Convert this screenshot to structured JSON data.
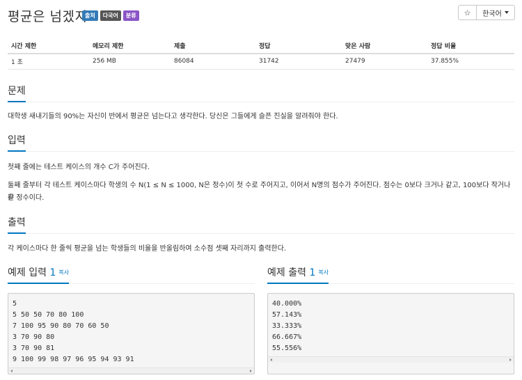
{
  "problem": {
    "title": "평균은 넘겠지",
    "badges": [
      "출처",
      "다국어",
      "분류"
    ]
  },
  "controls": {
    "star_icon": "☆",
    "language": "한국어"
  },
  "info_table": {
    "headers": [
      "시간 제한",
      "메모리 제한",
      "제출",
      "정답",
      "맞은 사람",
      "정답 비율"
    ],
    "values": [
      "1 초",
      "256 MB",
      "86084",
      "31742",
      "27479",
      "37.855%"
    ]
  },
  "sections": {
    "description": {
      "heading": "문제",
      "text": "대학생 새내기들의 90%는 자신이 반에서 평균은 넘는다고 생각한다. 당신은 그들에게 슬픈 진실을 알려줘야 한다."
    },
    "input": {
      "heading": "입력",
      "line1": "첫째 줄에는 테스트 케이스의 개수 C가 주어진다.",
      "line2a": "둘째 줄부터 각 테스트 케이스마다 학생의 수 N(1 ≤ N ≤ 1000, N은 정수)이 첫 수로 주어지고, 이어서 N명의 점수가 주어진다. 점수는 0보다 크거나 같고, 100보다 작거나 같",
      "line2b": "은 정수이다."
    },
    "output": {
      "heading": "출력",
      "text": "각 케이스마다 한 줄씩 평균을 넘는 학생들의 비율을 반올림하여 소수점 셋째 자리까지 출력한다."
    }
  },
  "sample_input": {
    "label": "예제 입력",
    "number": "1",
    "copy": "복사",
    "lines": [
      "5",
      "5 50 50 70 80 100",
      "7 100 95 90 80 70 60 50",
      "3 70 90 80",
      "3 70 90 81",
      "9 100 99 98 97 96 95 94 93 91"
    ]
  },
  "sample_output": {
    "label": "예제 출력",
    "number": "1",
    "copy": "복사",
    "lines": [
      "40.000%",
      "57.143%",
      "33.333%",
      "66.667%",
      "55.556%"
    ]
  }
}
